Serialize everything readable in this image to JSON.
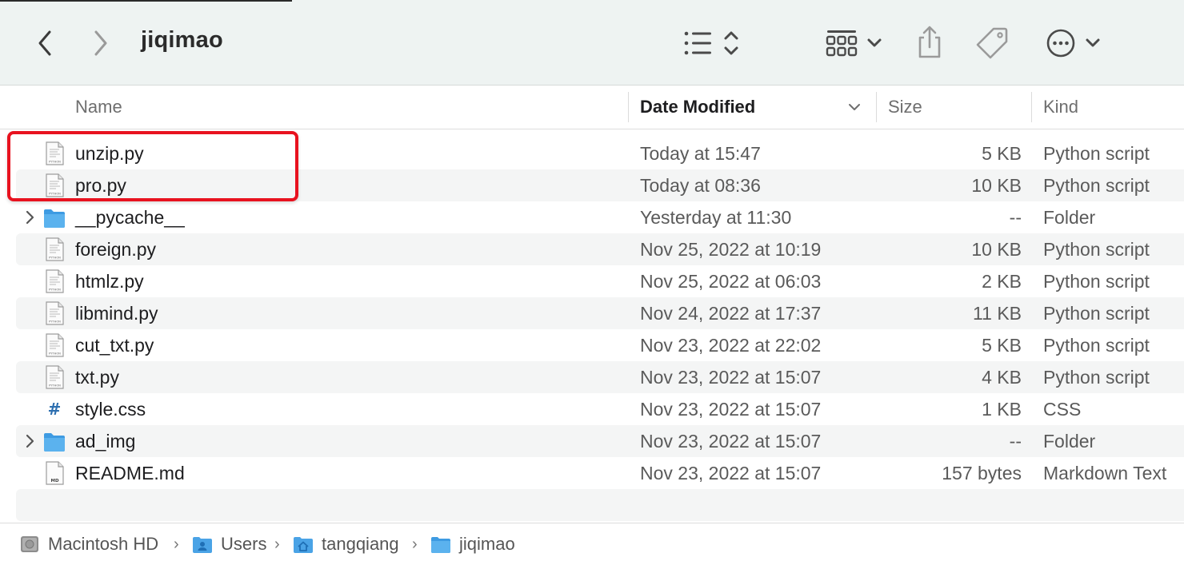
{
  "window": {
    "title": "jiqimao"
  },
  "toolbar": {
    "back_icon": "chevron-left-icon",
    "forward_icon": "chevron-right-icon",
    "view_icon": "list-view-icon",
    "group_icon": "grid-group-icon",
    "share_icon": "share-icon",
    "tag_icon": "tag-icon",
    "more_icon": "ellipsis-circle-icon"
  },
  "columns": {
    "name": "Name",
    "date": "Date Modified",
    "size": "Size",
    "kind": "Kind"
  },
  "files": [
    {
      "name": "unzip.py",
      "date": "Today at 15:47",
      "size": "5 KB",
      "kind": "Python script",
      "icon": "python-file-icon"
    },
    {
      "name": "pro.py",
      "date": "Today at 08:36",
      "size": "10 KB",
      "kind": "Python script",
      "icon": "python-file-icon"
    },
    {
      "name": "__pycache__",
      "date": "Yesterday at 11:30",
      "size": "--",
      "kind": "Folder",
      "icon": "folder-icon"
    },
    {
      "name": "foreign.py",
      "date": "Nov 25, 2022 at 10:19",
      "size": "10 KB",
      "kind": "Python script",
      "icon": "python-file-icon"
    },
    {
      "name": "htmlz.py",
      "date": "Nov 25, 2022 at 06:03",
      "size": "2 KB",
      "kind": "Python script",
      "icon": "python-file-icon"
    },
    {
      "name": "libmind.py",
      "date": "Nov 24, 2022 at 17:37",
      "size": "11 KB",
      "kind": "Python script",
      "icon": "python-file-icon"
    },
    {
      "name": "cut_txt.py",
      "date": "Nov 23, 2022 at 22:02",
      "size": "5 KB",
      "kind": "Python script",
      "icon": "python-file-icon"
    },
    {
      "name": "txt.py",
      "date": "Nov 23, 2022 at 15:07",
      "size": "4 KB",
      "kind": "Python script",
      "icon": "python-file-icon"
    },
    {
      "name": "style.css",
      "date": "Nov 23, 2022 at 15:07",
      "size": "1 KB",
      "kind": "CSS",
      "icon": "css-file-icon"
    },
    {
      "name": "ad_img",
      "date": "Nov 23, 2022 at 15:07",
      "size": "--",
      "kind": "Folder",
      "icon": "folder-icon"
    },
    {
      "name": "README.md",
      "date": "Nov 23, 2022 at 15:07",
      "size": "157 bytes",
      "kind": "Markdown Text",
      "icon": "markdown-file-icon"
    }
  ],
  "pathbar": {
    "items": [
      "Macintosh HD",
      "Users",
      "tangqiang",
      "jiqimao"
    ]
  },
  "colors": {
    "toolbar_bg": "#eef3f2",
    "alt_row": "#f4f5f5",
    "highlight": "#e8121f",
    "folder": "#4fa8e8"
  }
}
